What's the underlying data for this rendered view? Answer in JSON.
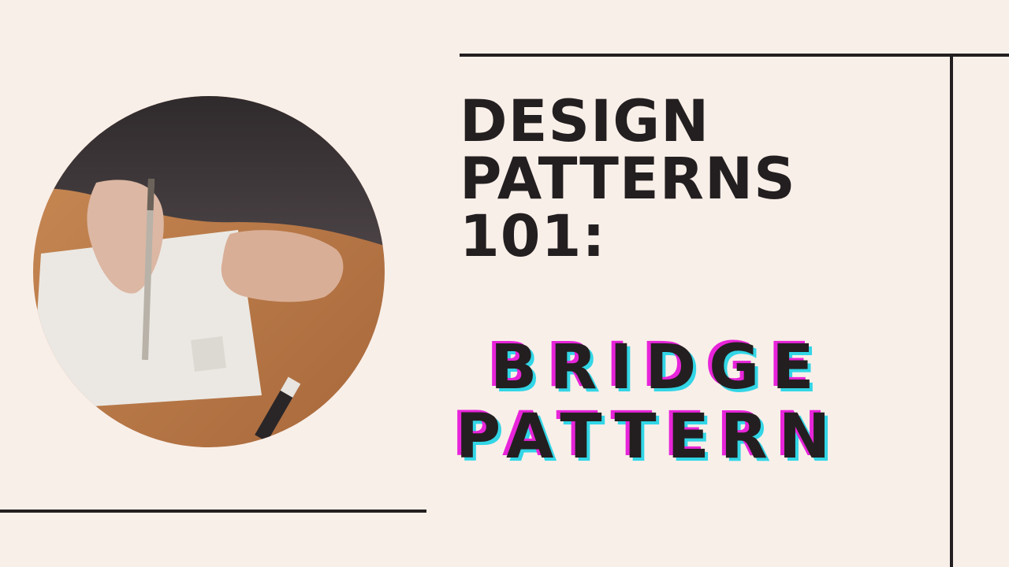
{
  "title": {
    "line1": "DESIGN",
    "line2": "PATTERNS",
    "line3": "101:"
  },
  "subtitle": {
    "line1": "BRIDGE",
    "line2": "PATTERN"
  },
  "colors": {
    "background": "#f9efe9",
    "ink": "#231f20",
    "accent_magenta": "#e724d9",
    "accent_cyan": "#32d6e6"
  },
  "photo": {
    "icon": "hand-drawing-photo"
  }
}
